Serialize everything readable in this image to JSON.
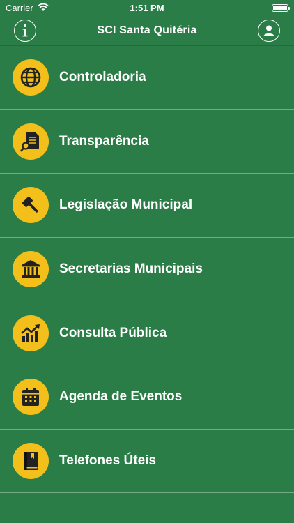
{
  "status_bar": {
    "carrier": "Carrier",
    "time": "1:51 PM"
  },
  "nav": {
    "title": "SCI Santa Quitéria",
    "left_icon": "info-icon",
    "right_icon": "user-icon"
  },
  "colors": {
    "background": "#2a7d46",
    "icon_bg": "#f3c01b",
    "text": "#ffffff"
  },
  "menu": [
    {
      "label": "Controladoria",
      "icon": "globe-icon"
    },
    {
      "label": "Transparência",
      "icon": "document-search-icon"
    },
    {
      "label": "Legislação Municipal",
      "icon": "gavel-icon"
    },
    {
      "label": "Secretarias Municipais",
      "icon": "institution-icon"
    },
    {
      "label": "Consulta Pública",
      "icon": "chart-up-icon"
    },
    {
      "label": "Agenda de Eventos",
      "icon": "calendar-icon"
    },
    {
      "label": "Telefones Úteis",
      "icon": "phone-book-icon"
    }
  ]
}
